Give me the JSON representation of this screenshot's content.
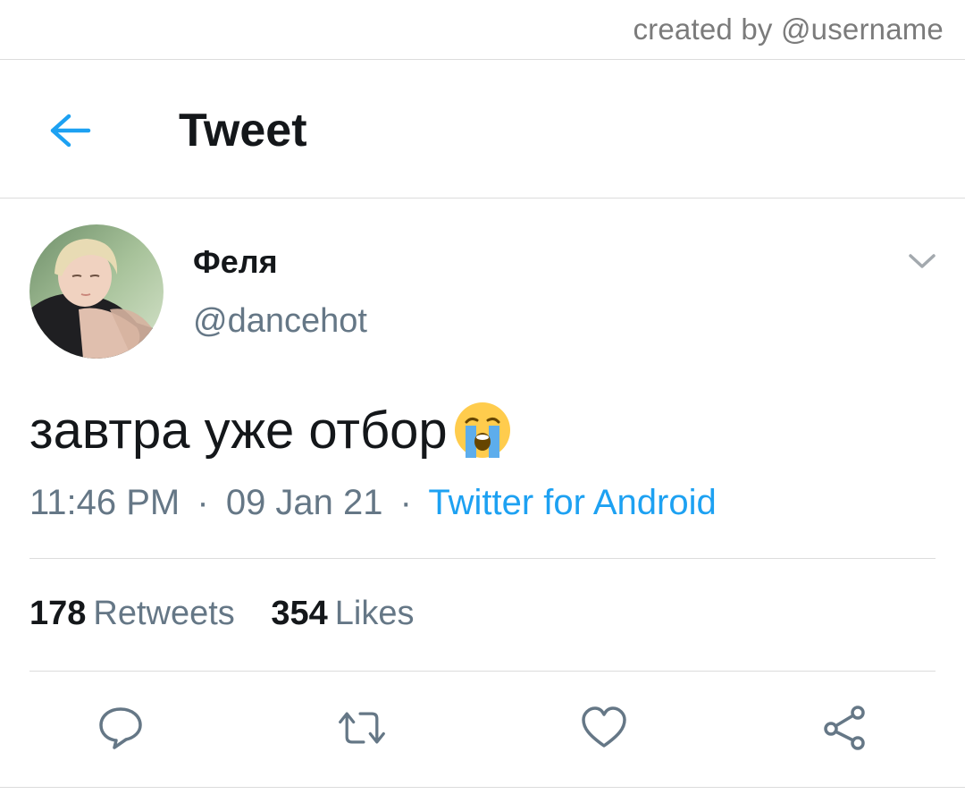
{
  "watermark": {
    "text": "created by @username"
  },
  "header": {
    "title": "Tweet",
    "back_icon": "arrow-left-icon",
    "accent_color": "#1da1f2"
  },
  "tweet": {
    "author": {
      "display_name": "Феля",
      "handle": "@dancehot",
      "avatar_icon": "avatar-photo"
    },
    "text": "завтра уже отбор",
    "emoji": "loudly-crying-face-emoji",
    "time": "11:46 PM",
    "date": "09 Jan 21",
    "separator": "·",
    "source": "Twitter for Android"
  },
  "stats": {
    "retweets_count": "178",
    "retweets_label": "Retweets",
    "likes_count": "354",
    "likes_label": "Likes"
  },
  "actions": [
    {
      "name": "reply",
      "icon": "comment-icon"
    },
    {
      "name": "retweet",
      "icon": "retweet-icon"
    },
    {
      "name": "like",
      "icon": "heart-icon"
    },
    {
      "name": "share",
      "icon": "share-icon"
    }
  ],
  "colors": {
    "text_primary": "#14171a",
    "text_secondary": "#657786",
    "link": "#1da1f2",
    "divider": "#dcdcdc"
  }
}
